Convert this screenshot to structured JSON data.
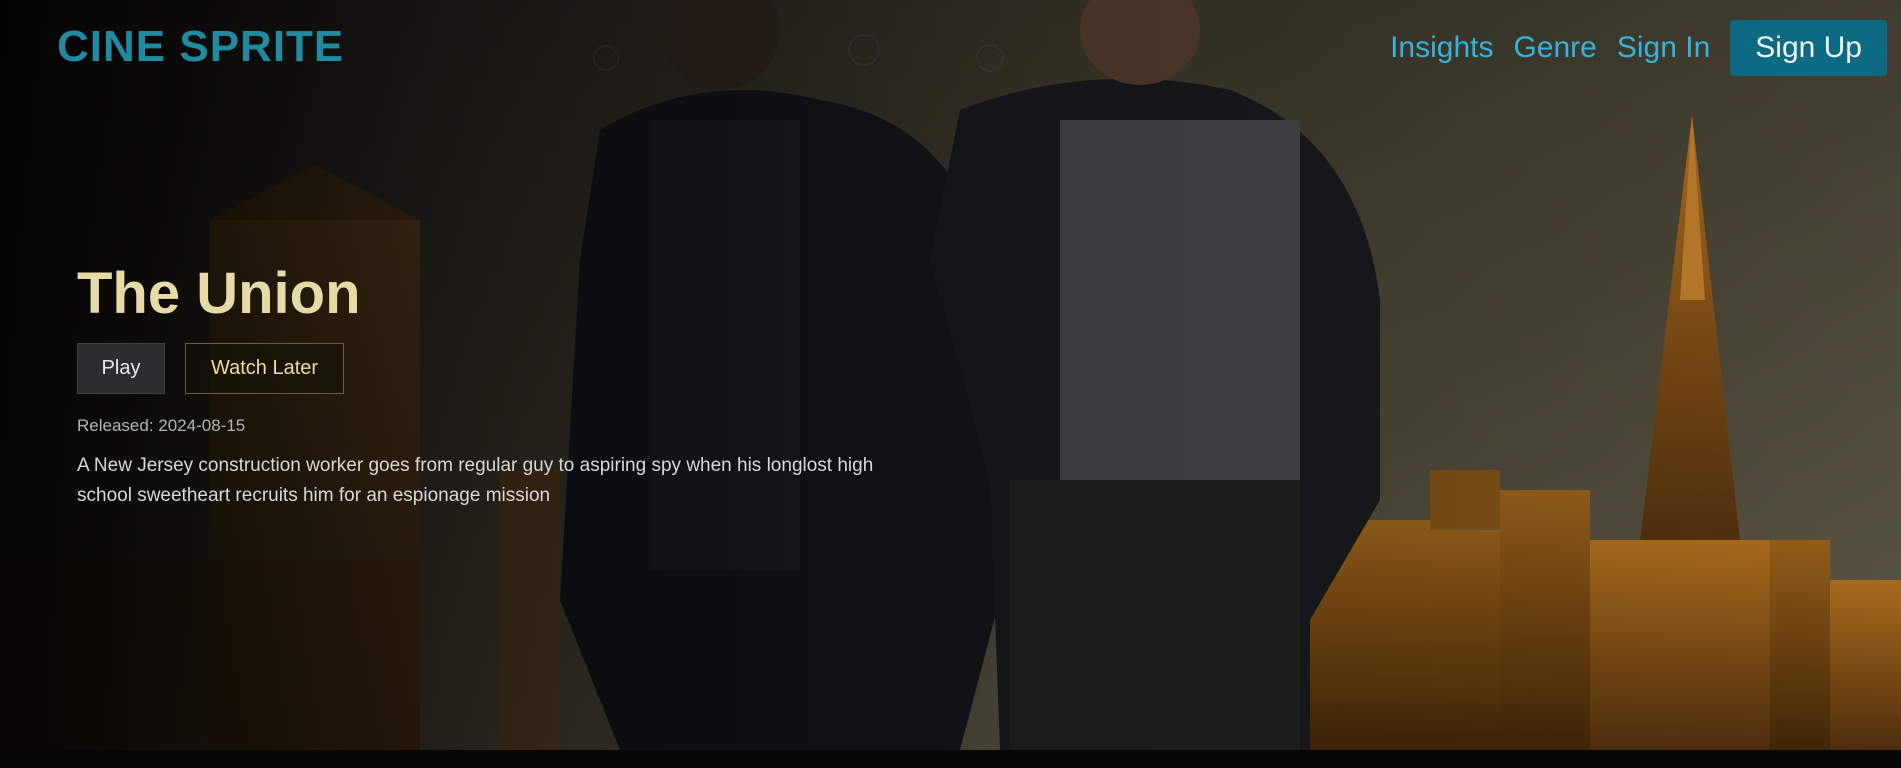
{
  "nav": {
    "logo": "CINE SPRITE",
    "links": [
      "Insights",
      "Genre",
      "Sign In"
    ],
    "signup_label": "Sign Up"
  },
  "movie": {
    "title": "The Union",
    "play_label": "Play",
    "watch_later_label": "Watch Later",
    "released": "Released: 2024-08-15",
    "description": "A New Jersey construction worker goes from regular guy to aspiring spy when his longlost high school sweetheart recruits him for an espionage mission"
  },
  "colors": {
    "logo": "#1f8aa0",
    "nav_link": "#33b4dc",
    "signup_bg": "#0d6a83",
    "title": "#e6dba6",
    "watch_later_text": "#eedd9a"
  }
}
